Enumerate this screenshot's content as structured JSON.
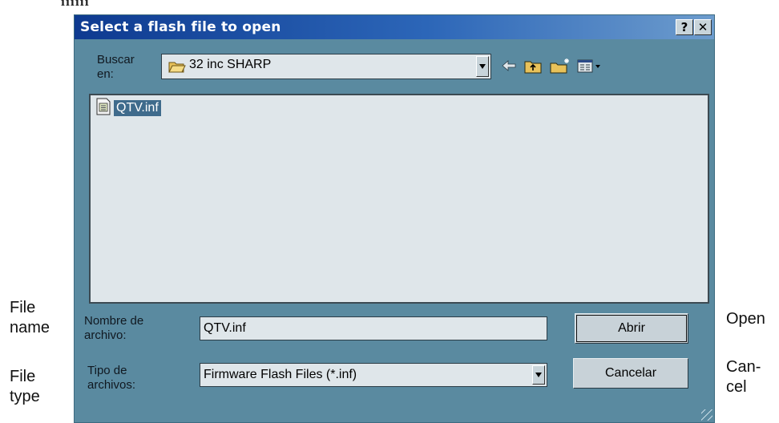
{
  "page": {
    "top_clip_text": "ıııııı"
  },
  "dialog": {
    "title": "Select a flash file to open",
    "help_button": "?",
    "close_button": "✕",
    "look_in_label": "Buscar en:",
    "look_in_label_line1": "Buscar",
    "look_in_label_line2": "en:",
    "look_in_value": "32 inc SHARP",
    "files": [
      {
        "name": "QTV.inf"
      }
    ],
    "filename_label_line1": "Nombre de",
    "filename_label_line2": "archivo:",
    "filename_value": "QTV.inf",
    "filetype_label_line1": "Tipo de",
    "filetype_label_line2": "archivos:",
    "filetype_value": "Firmware Flash Files (*.inf)",
    "open_button": "Abrir",
    "cancel_button": "Cancelar",
    "toolbar_icons": [
      "back-arrow-icon",
      "up-one-level-icon",
      "new-folder-icon",
      "view-menu-icon"
    ]
  },
  "annotations": {
    "file_name_1": "File",
    "file_name_2": "name",
    "file_type_1": "File",
    "file_type_2": "type",
    "open": "Open",
    "cancel_1": "Can-",
    "cancel_2": "cel"
  },
  "colors": {
    "titlebar_start": "#0e3a90",
    "titlebar_end": "#6d9ccd",
    "dialog_bg": "#5a8aa0",
    "selection": "#3f6b8c"
  }
}
